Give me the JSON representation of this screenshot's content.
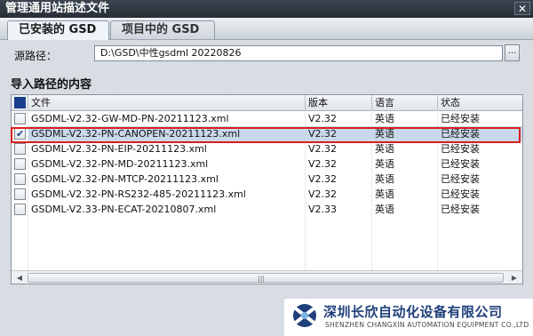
{
  "window": {
    "title": "管理通用站描述文件",
    "close_label": "✕"
  },
  "tabs": [
    {
      "label": "已安装的 GSD",
      "active": true
    },
    {
      "label": "项目中的 GSD",
      "active": false
    }
  ],
  "source_path": {
    "label": "源路径：",
    "value": "D:\\GSD\\中性gsdml 20220826",
    "browse_label": "..."
  },
  "section_title": "导入路径的内容",
  "table": {
    "columns": [
      "文件",
      "版本",
      "语言",
      "状态"
    ],
    "rows": [
      {
        "file": "GSDML-V2.32-GW-MD-PN-20211123.xml",
        "version": "V2.32",
        "language": "英语",
        "status": "已经安装",
        "checked": false
      },
      {
        "file": "GSDML-V2.32-PN-CANOPEN-20211123.xml",
        "version": "V2.32",
        "language": "英语",
        "status": "已经安装",
        "checked": true
      },
      {
        "file": "GSDML-V2.32-PN-EIP-20211123.xml",
        "version": "V2.32",
        "language": "英语",
        "status": "已经安装",
        "checked": false
      },
      {
        "file": "GSDML-V2.32-PN-MD-20211123.xml",
        "version": "V2.32",
        "language": "英语",
        "status": "已经安装",
        "checked": false
      },
      {
        "file": "GSDML-V2.32-PN-MTCP-20211123.xml",
        "version": "V2.32",
        "language": "英语",
        "status": "已经安装",
        "checked": false
      },
      {
        "file": "GSDML-V2.32-PN-RS232-485-20211123.xml",
        "version": "V2.32",
        "language": "英语",
        "status": "已经安装",
        "checked": false
      },
      {
        "file": "GSDML-V2.33-PN-ECAT-20210807.xml",
        "version": "V2.33",
        "language": "英语",
        "status": "已经安装",
        "checked": false
      }
    ]
  },
  "scrollbar": {
    "left_arrow": "◀",
    "right_arrow": "▶",
    "grip": "|||"
  },
  "watermark": {
    "name_cn": "深圳长欣自动化设备有限公司",
    "name_en": "SHENZHEN CHANGXIN AUTOMATION EQUIPMENT CO.,LTD"
  },
  "colors": {
    "highlight_border": "#d81f1f",
    "selected_row": "#c9d8ea",
    "brand_blue": "#1f3f7a"
  }
}
